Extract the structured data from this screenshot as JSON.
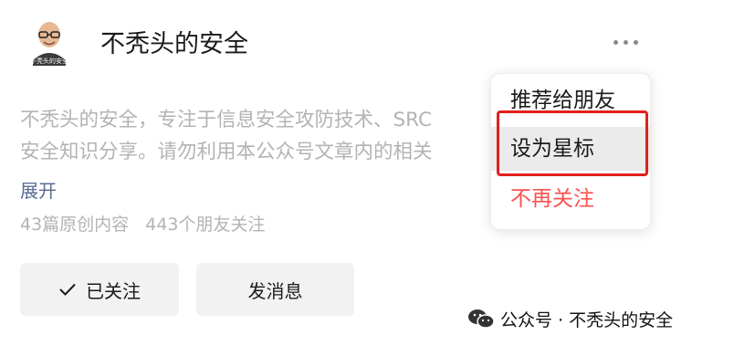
{
  "profile": {
    "name": "不秃头的安全",
    "avatar_caption": "不秃头的安全",
    "description_lines": [
      "不秃头的安全，专注于信息安全攻防技术、SRC",
      "安全知识分享。请勿利用本公众号文章内的相关"
    ],
    "expand_label": "展开",
    "original_count": "43篇原创内容",
    "friends_count": "443个朋友关注"
  },
  "actions": {
    "follow_label": "已关注",
    "message_label": "发消息"
  },
  "menu": {
    "recommend": "推荐给朋友",
    "star": "设为星标",
    "unfollow": "不再关注"
  },
  "watermark": {
    "text": "公众号 · 不秃头的安全"
  },
  "colors": {
    "link": "#576b95",
    "danger": "#fa5151",
    "highlight": "#e0201d"
  }
}
